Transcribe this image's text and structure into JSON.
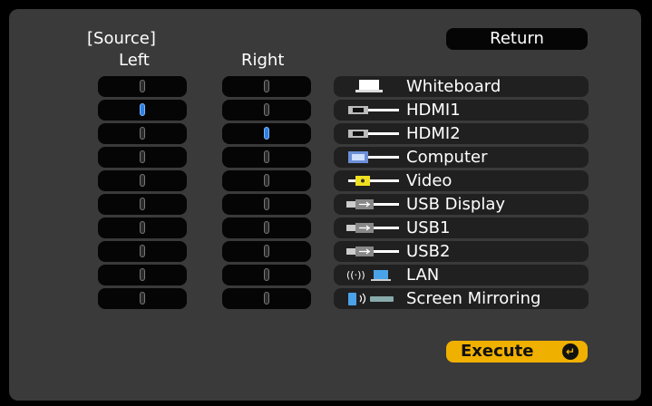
{
  "header": {
    "source": "[Source]",
    "left": "Left",
    "right": "Right"
  },
  "return_label": "Return",
  "execute_label": "Execute",
  "execute_icon": "↵",
  "sources": [
    {
      "label": "Whiteboard",
      "icon": "whiteboard-icon"
    },
    {
      "label": "HDMI1",
      "icon": "hdmi-icon"
    },
    {
      "label": "HDMI2",
      "icon": "hdmi-icon"
    },
    {
      "label": "Computer",
      "icon": "computer-vga-icon"
    },
    {
      "label": "Video",
      "icon": "video-rca-icon"
    },
    {
      "label": "USB Display",
      "icon": "usb-display-icon"
    },
    {
      "label": "USB1",
      "icon": "usb-icon"
    },
    {
      "label": "USB2",
      "icon": "usb-icon"
    },
    {
      "label": "LAN",
      "icon": "lan-icon"
    },
    {
      "label": "Screen Mirroring",
      "icon": "screen-mirroring-icon"
    }
  ],
  "left_selected": "HDMI1",
  "right_selected": "HDMI2"
}
